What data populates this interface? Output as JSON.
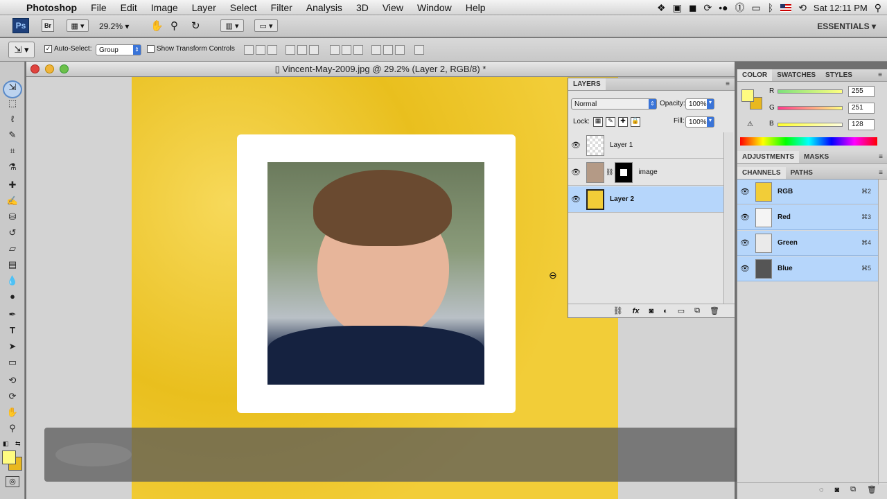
{
  "menubar": {
    "app": "Photoshop",
    "items": [
      "File",
      "Edit",
      "Image",
      "Layer",
      "Select",
      "Filter",
      "Analysis",
      "3D",
      "View",
      "Window",
      "Help"
    ],
    "clock": "Sat 12:11 PM"
  },
  "appbar": {
    "ps_logo": "Ps",
    "br_logo": "Br",
    "zoom": "29.2%",
    "workspace": "ESSENTIALS"
  },
  "options": {
    "auto_select_label": "Auto-Select:",
    "auto_select_value": "Group",
    "show_transform_label": "Show Transform Controls"
  },
  "document": {
    "title": "Vincent-May-2009.jpg @ 29.2% (Layer 2, RGB/8) *"
  },
  "layers_panel": {
    "tab": "LAYERS",
    "blend_mode": "Normal",
    "opacity_label": "Opacity:",
    "opacity": "100%",
    "lock_label": "Lock:",
    "fill_label": "Fill:",
    "fill": "100%",
    "layers": [
      {
        "name": "Layer 1",
        "selected": false
      },
      {
        "name": "image",
        "selected": false
      },
      {
        "name": "Layer 2",
        "selected": true
      }
    ],
    "bottom_icons": [
      "link-icon",
      "fx-icon",
      "mask-icon",
      "adjustment-icon",
      "folder-icon",
      "new-layer-icon",
      "trash-icon"
    ]
  },
  "color_panel": {
    "tabs": [
      "COLOR",
      "SWATCHES",
      "STYLES"
    ],
    "r_label": "R",
    "r": "255",
    "g_label": "G",
    "g": "251",
    "b_label": "B",
    "b": "128",
    "foreground": "#fffb80",
    "background": "#e9b81f"
  },
  "adjust_tabs": [
    "ADJUSTMENTS",
    "MASKS"
  ],
  "channels_panel": {
    "tabs": [
      "CHANNELS",
      "PATHS"
    ],
    "channels": [
      {
        "name": "RGB",
        "shortcut": "⌘2"
      },
      {
        "name": "Red",
        "shortcut": "⌘3"
      },
      {
        "name": "Green",
        "shortcut": "⌘4"
      },
      {
        "name": "Blue",
        "shortcut": "⌘5"
      }
    ]
  }
}
